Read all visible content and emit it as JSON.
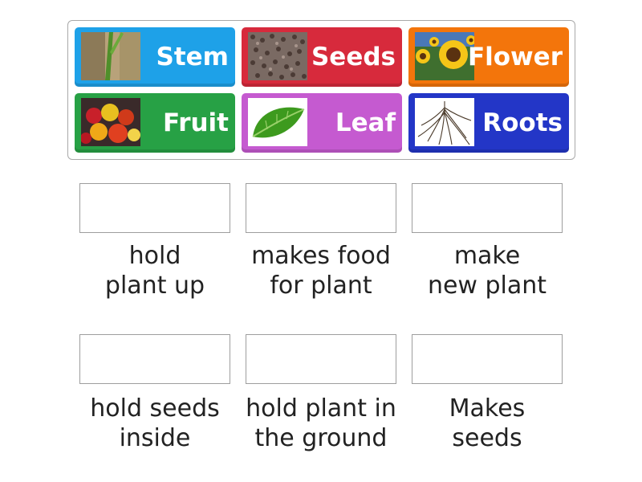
{
  "tiles": [
    {
      "label": "Stem",
      "color": "#1ea1e8",
      "image": "stem-image"
    },
    {
      "label": "Seeds",
      "color": "#d72a3c",
      "image": "seeds-image"
    },
    {
      "label": "Flower",
      "color": "#f3750b",
      "image": "sunflower-image"
    },
    {
      "label": "Fruit",
      "color": "#27a145",
      "image": "fruit-image"
    },
    {
      "label": "Leaf",
      "color": "#c55ad0",
      "image": "leaf-image"
    },
    {
      "label": "Roots",
      "color": "#2336c7",
      "image": "roots-image"
    }
  ],
  "targets": [
    {
      "line1": "hold",
      "line2": "plant up"
    },
    {
      "line1": "makes food",
      "line2": "for plant"
    },
    {
      "line1": "make",
      "line2": "new plant"
    },
    {
      "line1": "hold seeds",
      "line2": "inside"
    },
    {
      "line1": "hold plant in",
      "line2": "the ground"
    },
    {
      "line1": "Makes",
      "line2": "seeds"
    }
  ]
}
